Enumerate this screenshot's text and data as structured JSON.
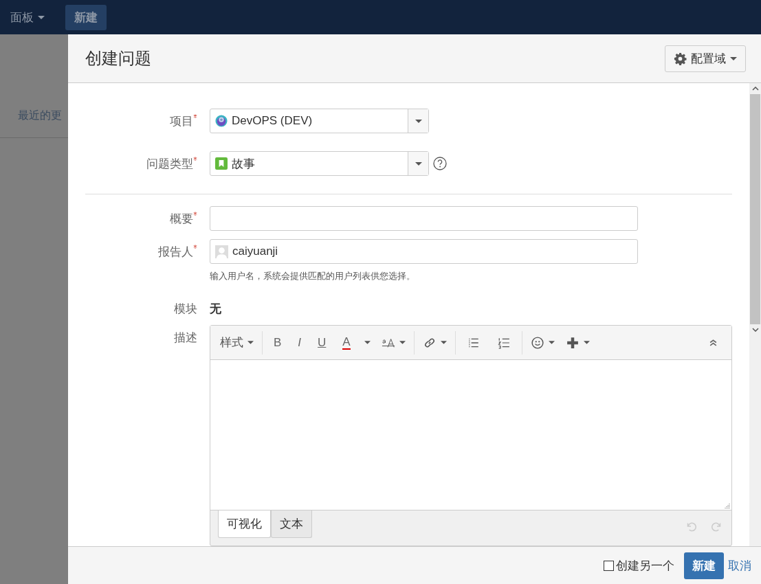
{
  "top_nav": {
    "items": [
      {
        "label": "面板",
        "kind": "menu"
      },
      {
        "label": "新建",
        "kind": "button"
      }
    ]
  },
  "background_page": {
    "heading": "最近的更"
  },
  "dialog": {
    "title": "创建问题",
    "config_button": "配置域",
    "fields": [
      {
        "kind": "project-select",
        "label": "项目",
        "required": true,
        "value": "DevOPS (DEV)",
        "help": false
      },
      {
        "kind": "type-select",
        "label": "问题类型",
        "required": true,
        "value": "故事",
        "help": true
      },
      {
        "kind": "divider"
      },
      {
        "kind": "text",
        "label": "概要",
        "required": true
      },
      {
        "kind": "user",
        "label": "报告人",
        "required": true,
        "value": "caiyuanji",
        "hint": "输入用户名，系统会提供匹配的用户列表供您选择。"
      },
      {
        "kind": "static",
        "label": "模块",
        "required": false,
        "value": "无"
      },
      {
        "kind": "editor",
        "label": "描述",
        "required": false
      }
    ],
    "editor": {
      "toolbar": [
        [
          {
            "kind": "style",
            "label": "样式",
            "caret": true
          }
        ],
        [
          {
            "kind": "bold",
            "label": "B",
            "caret": false
          },
          {
            "kind": "italic",
            "label": "I",
            "caret": false
          },
          {
            "kind": "underline",
            "label": "U",
            "caret": false
          },
          {
            "kind": "color",
            "label": "A",
            "caret": false
          },
          {
            "kind": "caret-only",
            "caret": true
          },
          {
            "kind": "fontsize",
            "caret": true
          }
        ],
        [
          {
            "kind": "link",
            "caret": true
          }
        ],
        [
          {
            "kind": "bullets",
            "caret": false
          },
          {
            "kind": "numbers",
            "caret": false
          }
        ],
        [
          {
            "kind": "emoji",
            "caret": true
          },
          {
            "kind": "plus",
            "caret": true
          }
        ]
      ],
      "tabs": [
        {
          "label": "可视化",
          "selected": true
        },
        {
          "label": "文本",
          "selected": false
        }
      ]
    },
    "footer": {
      "create_another": {
        "label": "创建另一个",
        "checked": false
      },
      "submit": "新建",
      "cancel": "取消"
    }
  }
}
